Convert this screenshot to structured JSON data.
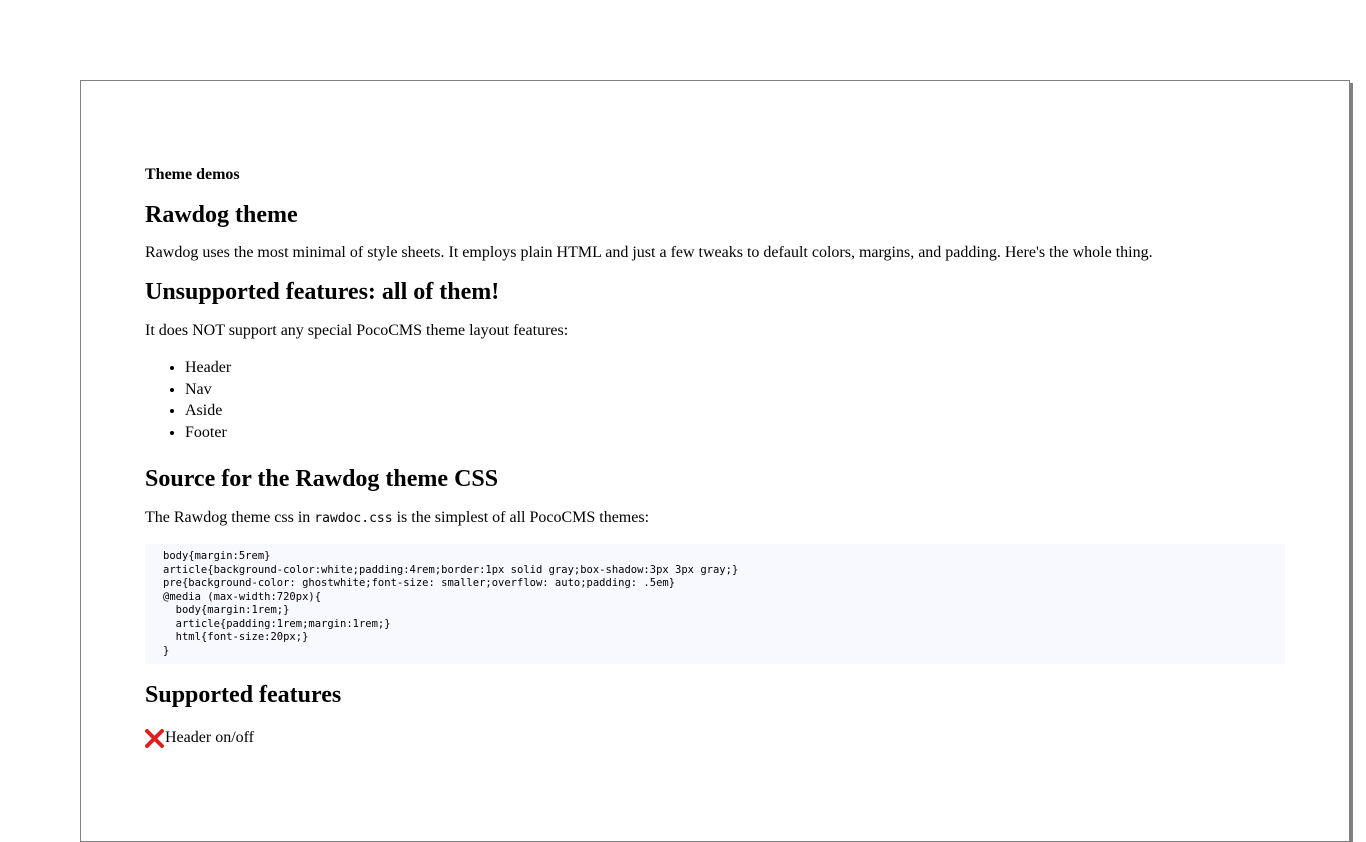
{
  "kicker": "Theme demos",
  "heading_rawdog": "Rawdog theme",
  "intro": "Rawdog uses the most minimal of style sheets. It employs plain HTML and just a few tweaks to default colors, margins, and padding. Here's the whole thing.",
  "heading_unsupported": "Unsupported features: all of them!",
  "not_support_text": "It does NOT support any special PocoCMS theme layout features:",
  "unsupported_list": [
    "Header",
    "Nav",
    "Aside",
    "Footer"
  ],
  "heading_source": "Source for the Rawdog theme CSS",
  "source_text_before": "The Rawdog theme css in ",
  "source_filename": "rawdoc.css",
  "source_text_after": " is the simplest of all PocoCMS themes:",
  "css_source": "body{margin:5rem}\narticle{background-color:white;padding:4rem;border:1px solid gray;box-shadow:3px 3px gray;}\npre{background-color: ghostwhite;font-size: smaller;overflow: auto;padding: .5em}\n@media (max-width:720px){\n  body{margin:1rem;}\n  article{padding:1rem;margin:1rem;}\n  html{font-size:20px;}\n}",
  "heading_supported": "Supported features",
  "supported_features": [
    {
      "icon": "red-x-icon",
      "label": "Header on/off"
    }
  ],
  "colors": {
    "pre_background": "#f8f8ff",
    "border": "#808080",
    "x_icon": "#e02020"
  }
}
